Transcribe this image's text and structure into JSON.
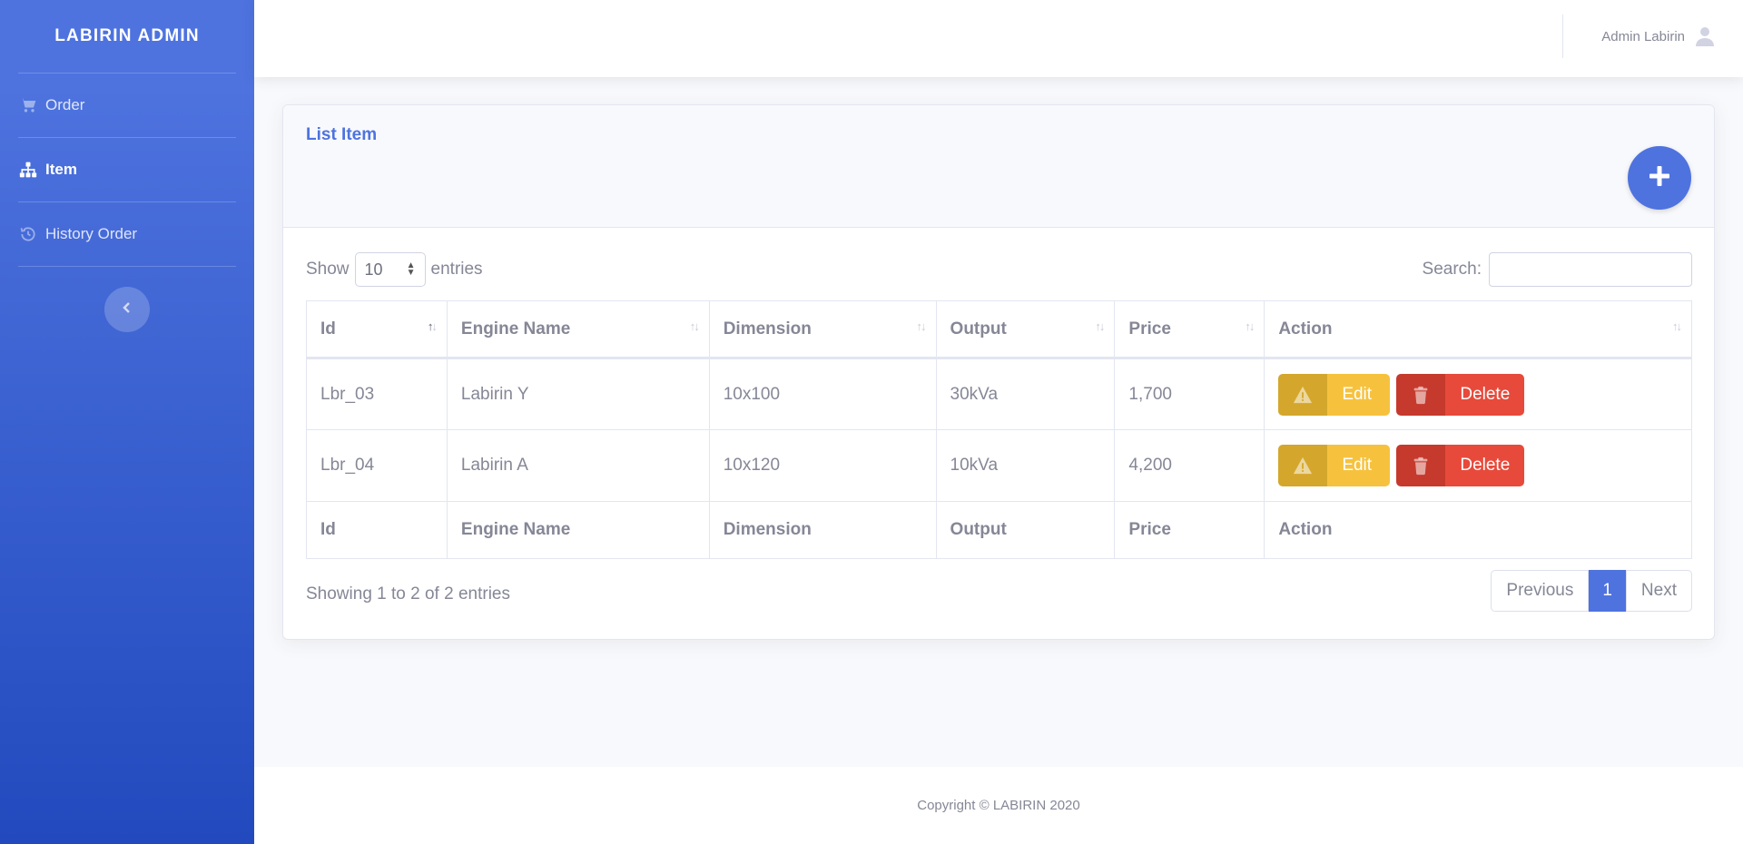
{
  "sidebar": {
    "brand": "LABIRIN ADMIN",
    "items": [
      {
        "label": "Order",
        "icon": "cart-icon",
        "active": false
      },
      {
        "label": "Item",
        "icon": "sitemap-icon",
        "active": true
      },
      {
        "label": "History Order",
        "icon": "history-icon",
        "active": false
      }
    ],
    "toggle_icon": "chevron-left-icon"
  },
  "topbar": {
    "user_name": "Admin Labirin",
    "user_icon": "user-icon"
  },
  "card": {
    "title": "List Item",
    "add_icon": "plus-icon"
  },
  "table_controls": {
    "show_label": "Show",
    "entries_value": "10",
    "entries_label": "entries",
    "search_label": "Search:",
    "search_value": ""
  },
  "table": {
    "columns": [
      "Id",
      "Engine Name",
      "Dimension",
      "Output",
      "Price",
      "Action"
    ],
    "rows": [
      {
        "id": "Lbr_03",
        "engine_name": "Labirin Y",
        "dimension": "10x100",
        "output": "30kVa",
        "price": "1,700"
      },
      {
        "id": "Lbr_04",
        "engine_name": "Labirin A",
        "dimension": "10x120",
        "output": "10kVa",
        "price": "4,200"
      }
    ],
    "edit_label": "Edit",
    "delete_label": "Delete"
  },
  "pagination": {
    "info": "Showing 1 to 2 of 2 entries",
    "previous": "Previous",
    "current": "1",
    "next": "Next"
  },
  "footer": {
    "copyright": "Copyright © LABIRIN 2020"
  },
  "colors": {
    "primary": "#4e73df",
    "warning": "#f6c23e",
    "danger": "#e74a3b"
  }
}
